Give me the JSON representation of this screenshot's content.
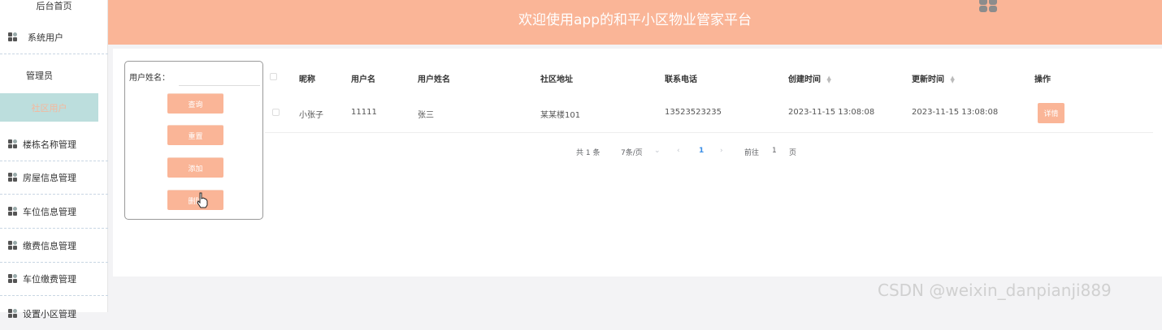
{
  "header": {
    "title": "欢迎使用app的和平小区物业管家平台"
  },
  "sidebar": {
    "items": [
      {
        "label": "后台首页"
      },
      {
        "label": "系统用户"
      },
      {
        "label": "管理员"
      },
      {
        "label": "社区用户"
      },
      {
        "label": "楼栋名称管理"
      },
      {
        "label": "房屋信息管理"
      },
      {
        "label": "车位信息管理"
      },
      {
        "label": "缴费信息管理"
      },
      {
        "label": "车位缴费管理"
      },
      {
        "label": "设置小区管理"
      }
    ]
  },
  "search": {
    "label": "用户姓名：",
    "value": "",
    "placeholder": "",
    "buttons": {
      "query": "查询",
      "reset": "重置",
      "add": "添加",
      "delete": "删除"
    }
  },
  "table": {
    "headers": {
      "nickname": "昵称",
      "username": "用户名",
      "realname": "用户姓名",
      "address": "社区地址",
      "phone": "联系电话",
      "created": "创建时间",
      "updated": "更新时间",
      "actions": "操作"
    },
    "rows": [
      {
        "nickname": "小张子",
        "username": "11111",
        "realname": "张三",
        "address": "某某楼101",
        "phone": "13523523235",
        "created": "2023-11-15 13:08:08",
        "updated": "2023-11-15 13:08:08",
        "action_label": "详情"
      }
    ]
  },
  "pagination": {
    "total": "共 1 条",
    "page_size": "7条/页",
    "current_page": "1",
    "goto_label": "前往",
    "goto_value": "1",
    "page_suffix": "页"
  },
  "watermark": "CSDN @weixin_danpianji889",
  "colors": {
    "header": "#fab597",
    "active_sidebar": "#bcdedd",
    "button": "#fab597",
    "pagination_active": "#3a8ee6"
  }
}
